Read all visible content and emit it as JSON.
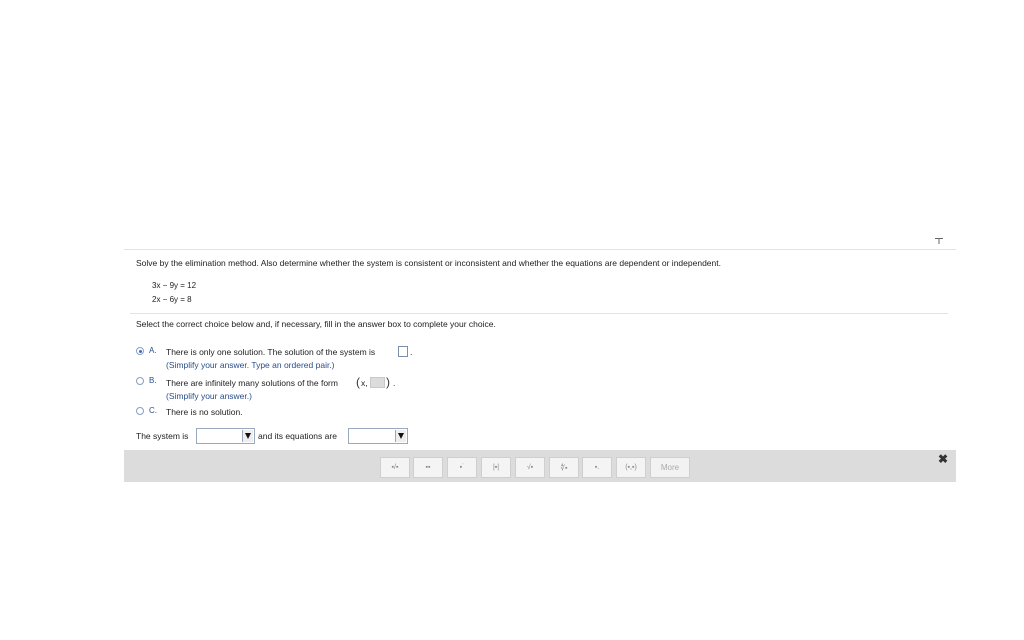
{
  "question": {
    "prompt": "Solve by the elimination method. Also determine whether the system is consistent or inconsistent and whether the equations are dependent or independent.",
    "equations": [
      "3x − 9y  = 12",
      "2x − 6y  = 8"
    ]
  },
  "instructions": "Select the correct choice below and, if necessary, fill in the answer box to complete your choice.",
  "choices": [
    {
      "letter": "A.",
      "text": "There is only one solution. The solution of the system is",
      "hint": "(Simplify your answer. Type an ordered pair.)",
      "selected": true
    },
    {
      "letter": "B.",
      "text": "There are infinitely many solutions of the form",
      "form_prefix": "x,",
      "hint": "(Simplify your answer.)",
      "selected": false
    },
    {
      "letter": "C.",
      "text": "There is no solution.",
      "selected": false
    }
  ],
  "sentence": {
    "part1": "The system is",
    "part2": "and its equations are",
    "select1_value": "",
    "select2_value": ""
  },
  "toolbar": {
    "buttons": [
      {
        "icon": "fraction-icon",
        "glyph": "▪/▪"
      },
      {
        "icon": "mixed-number-icon",
        "glyph": "▪▪"
      },
      {
        "icon": "exponent-icon",
        "glyph": "▪˙"
      },
      {
        "icon": "absolute-value-icon",
        "glyph": "|▪|"
      },
      {
        "icon": "square-root-icon",
        "glyph": "√▪"
      },
      {
        "icon": "nth-root-icon",
        "glyph": "∜▪"
      },
      {
        "icon": "subscript-icon",
        "glyph": "▪."
      },
      {
        "icon": "ordered-pair-icon",
        "glyph": "(▪,▪)"
      }
    ],
    "more_label": "More",
    "close_glyph": "✖"
  },
  "colors": {
    "accent": "#2f6fd0",
    "hint_text": "#2a4e8a",
    "toolbar_bg": "#dcdcdc"
  }
}
